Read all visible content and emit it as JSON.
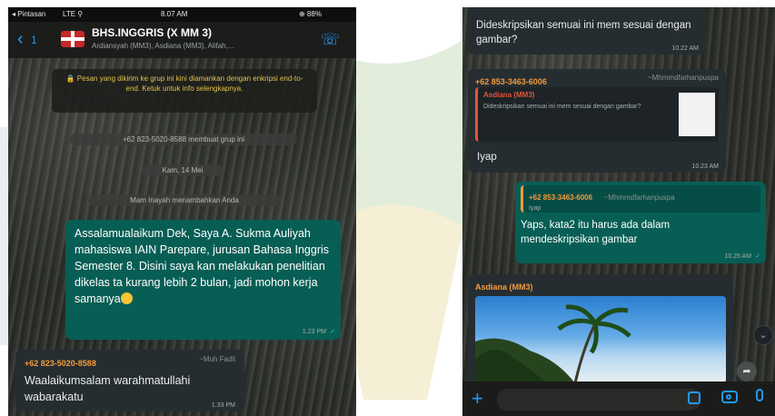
{
  "left_screen": {
    "status": {
      "carrier": "◂ Pintasan",
      "signal": "LTE ⚲",
      "time": "8.07 AM",
      "battery": "⊕ 88%"
    },
    "header": {
      "back_count": "1",
      "title": "BHS.INGGRIS (X MM 3)",
      "subtitle": "Ardiansyah (MM3), Asdiana (MM3), Alifah,..."
    },
    "encryption_notice": "🔒 Pesan yang dikirim ke grup ini kini diamankan dengan enkripsi end-to-end. Ketuk untuk info selengkapnya.",
    "system_created": "+62 823-5020-8588 membuat grup ini",
    "date_chip": "Kam, 14 Mei",
    "system_added": "Mam Inayah menambahkan Anda",
    "outgoing_message": {
      "text": "Assalamualaikum Dek, Saya A. Sukma Auliyah mahasiswa IAIN Parepare, jurusan Bahasa Inggris Semester 8. Disini saya kan melakukan penelitian dikelas ta kurang lebih 2 bulan, jadi mohon  kerja samanya",
      "time": "1.23 PM",
      "tick": "✓"
    },
    "incoming_message": {
      "sender": "+62 823-5020-8588",
      "alias": "~Muh Fadli",
      "text": "Waalaikumsalam warahmatullahi wabarakatu",
      "time": "1.33 PM"
    }
  },
  "right_screen": {
    "top_message": {
      "text": "Dideskripsikan semuai ini mem sesuai dengan gambar?",
      "time": "10.22 AM"
    },
    "reply_message": {
      "sender": "+62 853-3463-6006",
      "alias": "~Mhmmdfarhanpuspa",
      "quote_name": "Asdiana (MM3)",
      "quote_text": "Dideskripsikan semuai ini mem sesuai dengan gambar?",
      "text": "Iyap",
      "time": "10.23 AM"
    },
    "outgoing_reply": {
      "quote_sender": "+62 853-3463-6006",
      "quote_alias": "~Mhmmdfarhanpuspa",
      "quote_text": "Iyap",
      "text": "Yaps, kata2 itu harus ada dalam mendeskripsikan gambar",
      "time": "10.25 AM",
      "tick": "✓"
    },
    "image_message": {
      "sender": "Asdiana (MM3)"
    },
    "scroll_icon": "⌄",
    "forward_icon": "➦"
  },
  "icons": {
    "back": "‹",
    "call": "☏",
    "plus": "+"
  },
  "colors": {
    "outgoing": "#075e54",
    "incoming": "#262d31",
    "accent": "#1f9bff",
    "sender_name": "#f29a3c"
  }
}
